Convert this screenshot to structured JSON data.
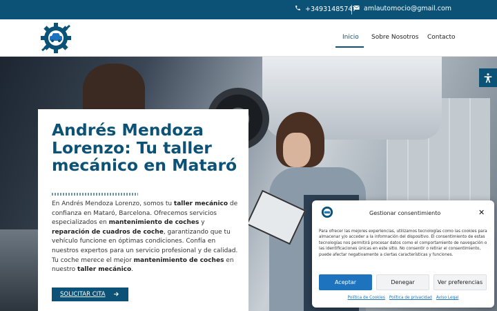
{
  "topbar": {
    "phone": "+34931485747",
    "email": "amlautomocio@gmail.com"
  },
  "nav": {
    "items": [
      "Inicio",
      "Sobre Nosotros",
      "Contacto"
    ],
    "active": "Inicio"
  },
  "hero": {
    "title": "Andrés Mendoza Lorenzo: Tu taller mecánico en Mataró",
    "paragraph": [
      {
        "text": "En Andrés Mendoza Lorenzo, somos tu ",
        "bold": false
      },
      {
        "text": "taller mecánico",
        "bold": true
      },
      {
        "text": " de confianza en Mataró, Barcelona. Ofrecemos servicios especializados en ",
        "bold": false
      },
      {
        "text": "mantenimiento de coches",
        "bold": true
      },
      {
        "text": " y ",
        "bold": false
      },
      {
        "text": "reparación de cuadros de coche",
        "bold": true
      },
      {
        "text": ", garantizando que tu vehículo funcione en óptimas condiciones. Confía en nuestros expertos para un servicio profesional y de calidad. Tu coche merece el mejor ",
        "bold": false
      },
      {
        "text": "mantenimiento de coches",
        "bold": true
      },
      {
        "text": " en nuestro ",
        "bold": false
      },
      {
        "text": "taller mecánico",
        "bold": true
      },
      {
        "text": ".",
        "bold": false
      }
    ],
    "cta_label": "SOLICITAR CITA"
  },
  "consent": {
    "title": "Gestionar consentimiento",
    "text": "Para ofrecer las mejores experiencias, utilizamos tecnologías como las cookies para almacenar y/o acceder a la información del dispositivo. El consentimiento de estas tecnologías nos permitirá procesar datos como el comportamiento de navegación o las identificaciones únicas en este sitio. No consentir o retirar el consentimiento, puede afectar negativamente a ciertas características y funciones.",
    "accept": "Aceptar",
    "deny": "Denegar",
    "preferences": "Ver preferencias",
    "links": [
      "Política de Cookies",
      "Política de privacidad",
      "Aviso Legal"
    ]
  },
  "colors": {
    "brand": "#0b5276",
    "accept_button": "#1e73be"
  },
  "icons": [
    "phone-icon",
    "mail-icon",
    "gear-car-logo",
    "arrow-right-icon",
    "accessibility-icon",
    "close-icon"
  ]
}
